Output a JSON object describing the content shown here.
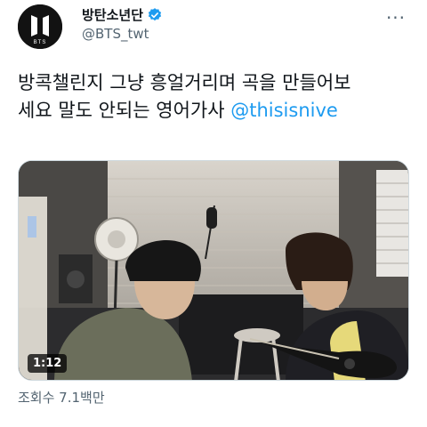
{
  "author": {
    "display_name": "방탄소년단",
    "handle": "@BTS_twt",
    "verified": true,
    "avatar_text": "BTS"
  },
  "tweet": {
    "text_line1": "방콕챌린지 그냥 흥얼거리며 곡을 만들어보",
    "text_line2_plain": "세요 말도 안되는 영어가사 ",
    "mention": "@thisisnive"
  },
  "media": {
    "type": "video",
    "duration": "1:12"
  },
  "stats": {
    "views": "조회수 7.1백만"
  },
  "colors": {
    "link": "#1d9bf0",
    "secondary_text": "#536471",
    "verified_badge": "#1d9bf0"
  },
  "icons": {
    "more": "more-horizontal-icon",
    "verified": "verified-badge-icon"
  }
}
